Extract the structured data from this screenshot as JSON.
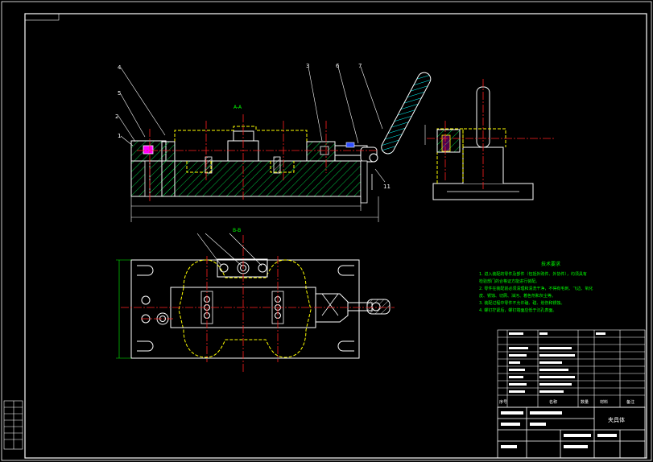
{
  "colors": {
    "background": "#000000",
    "frame": "#ffffff",
    "outline": "#ffffff",
    "hidden_line": "#ffff00",
    "center_line": "#ff2020",
    "hatch": "#00cc44",
    "handle_hatch": "#00ffff",
    "dimension": "#00ffff",
    "notes": "#00ff00",
    "label": "#ffffff",
    "accent_magenta": "#ff00ff",
    "accent_blue": "#3050ff"
  },
  "balloons": {
    "b1": "1",
    "b2": "2",
    "b3": "3",
    "b4": "4",
    "b5": "5",
    "b6": "6",
    "b7": "7",
    "b11": "11"
  },
  "section_labels": {
    "top": "A-A",
    "bottom": "B-B"
  },
  "notes": {
    "title": "技术要求",
    "line1": "1. 进入装配的零件及部件（包括外购件、外协件），均须具有",
    "line2": "检验部门的合格证方能进行装配。",
    "line3": "2. 零件在装配前必须清理和清洗干净，不得有毛刺、飞边、氧化",
    "line4": "皮、锈蚀、切屑、油污、着色剂和灰尘等。",
    "line5": "3. 装配过程中零件不允许磕、碰、划伤和锈蚀。",
    "line6": "4. 螺钉拧紧后，螺钉端面应低于沉孔表面。"
  },
  "title_block": {
    "label_seq": "序号",
    "label_name": "名称",
    "label_qty": "数量",
    "label_material": "材料",
    "label_note": "备注",
    "drawing_title": "夹具体"
  }
}
